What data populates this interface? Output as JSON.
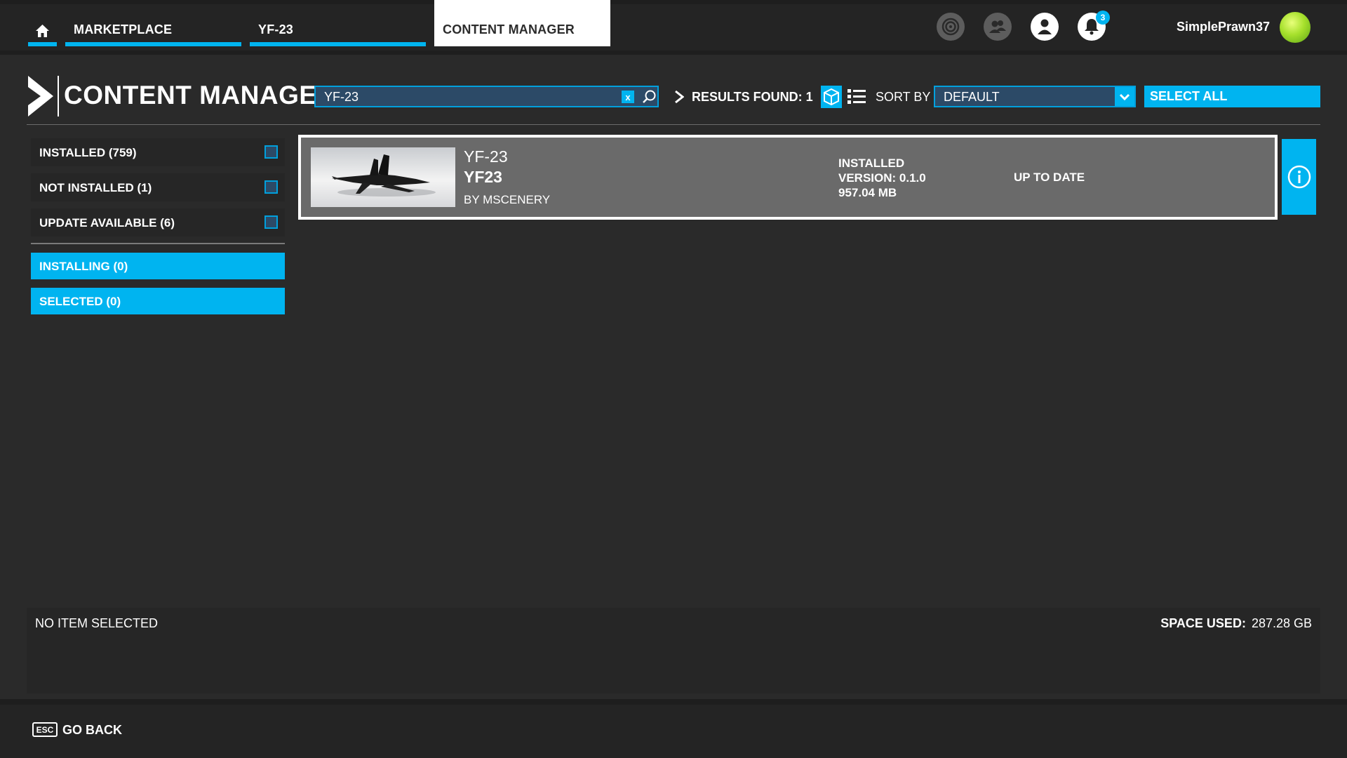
{
  "topbar": {
    "tabs": [
      {
        "label": "MARKETPLACE"
      },
      {
        "label": "YF-23"
      },
      {
        "label": "CONTENT MANAGER"
      }
    ],
    "notification_count": "3",
    "username": "SimplePrawn37",
    "icons": [
      "home-icon",
      "achievements-icon",
      "friends-icon",
      "profile-icon",
      "bell-icon"
    ]
  },
  "header": {
    "title": "CONTENT MANAGER",
    "search": {
      "value": "YF-23",
      "clear_label": "x"
    },
    "results_label": "RESULTS FOUND: 1",
    "sort_label": "SORT BY",
    "sort_value": "DEFAULT",
    "select_all": "SELECT ALL"
  },
  "filters": [
    {
      "label": "INSTALLED (759)",
      "checked": false
    },
    {
      "label": "NOT INSTALLED (1)",
      "checked": false
    },
    {
      "label": "UPDATE AVAILABLE (6)",
      "checked": false
    }
  ],
  "status_rows": [
    {
      "label": "INSTALLING (0)"
    },
    {
      "label": "SELECTED (0)"
    }
  ],
  "result": {
    "name": "YF-23",
    "title": "YF23",
    "author": "BY MSCENERY",
    "state": "INSTALLED",
    "version": "VERSION: 0.1.0",
    "size": "957.04 MB",
    "update_status": "UP TO DATE"
  },
  "bottom": {
    "no_item": "NO ITEM SELECTED",
    "space_used_label": "SPACE USED:",
    "space_used_value": "287.28 GB"
  },
  "footer": {
    "key": "ESC",
    "back_label": "GO BACK"
  },
  "colors": {
    "accent": "#00b4f0",
    "background": "#2a2a2a",
    "card": "#6a6a6a"
  }
}
